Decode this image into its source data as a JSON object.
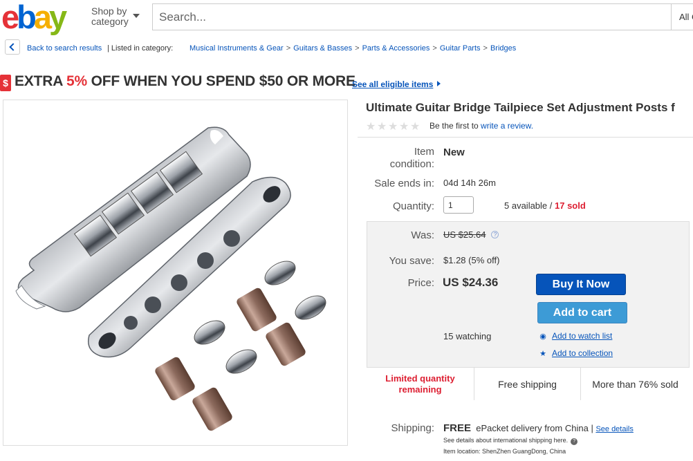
{
  "header": {
    "logo_letters": [
      "e",
      "b",
      "a",
      "y"
    ],
    "shop_by_line1": "Shop by",
    "shop_by_line2": "category",
    "search_placeholder": "Search...",
    "category_select": "All C"
  },
  "breadcrumb": {
    "back_label": "Back to search results",
    "listed_in": "| Listed in category:",
    "items": [
      "Musical Instruments & Gear",
      "Guitars & Basses",
      "Parts & Accessories",
      "Guitar Parts",
      "Bridges"
    ]
  },
  "promo": {
    "icon": "$",
    "text_before": "EXTRA ",
    "text_highlight": "5%",
    "text_after": " OFF WHEN YOU SPEND $50 OR MORE",
    "link_label": "See all eligible items"
  },
  "listing": {
    "title": "Ultimate Guitar Bridge Tailpiece Set Adjustment Posts f",
    "rating_stars": 0,
    "review_prefix": "Be the first to ",
    "review_link": "write a review.",
    "condition_label_1": "Item",
    "condition_label_2": "condition:",
    "condition_value": "New",
    "sale_ends_label": "Sale ends in:",
    "sale_ends_value": "04d 14h 26m",
    "quantity_label": "Quantity:",
    "quantity_value": "1",
    "available": "5 available / ",
    "sold": "17 sold",
    "was_label": "Was:",
    "was_value": "US $25.64",
    "info_icon": "?",
    "save_label": "You save:",
    "save_value": "$1.28 (5% off)",
    "price_label": "Price:",
    "price_value": "US $24.36",
    "buy_now": "Buy It Now",
    "add_to_cart": "Add to cart",
    "watching": "15 watching",
    "add_watch": "Add to watch list",
    "add_collection": "Add to collection",
    "features": [
      "Limited quantity remaining",
      "Free shipping",
      "More than 76% sold"
    ],
    "shipping_label": "Shipping:",
    "shipping_free": "FREE",
    "shipping_method": "ePacket delivery from China",
    "see_details": "See details",
    "intl_note": "See details about international shipping here.",
    "item_location": "Item location:  ShenZhen GuangDong, China"
  },
  "colors": {
    "ebay_red": "#e53238",
    "ebay_blue": "#0064d2",
    "ebay_yellow": "#f5af02",
    "ebay_green": "#86b817",
    "link": "#0654ba",
    "buy_button": "#0654ba",
    "cart_button": "#3d9bd6"
  },
  "icons": {
    "back": "chevron-left-icon",
    "watch": "eye-icon",
    "collection": "star-icon",
    "promo": "dollar-tag-icon"
  }
}
